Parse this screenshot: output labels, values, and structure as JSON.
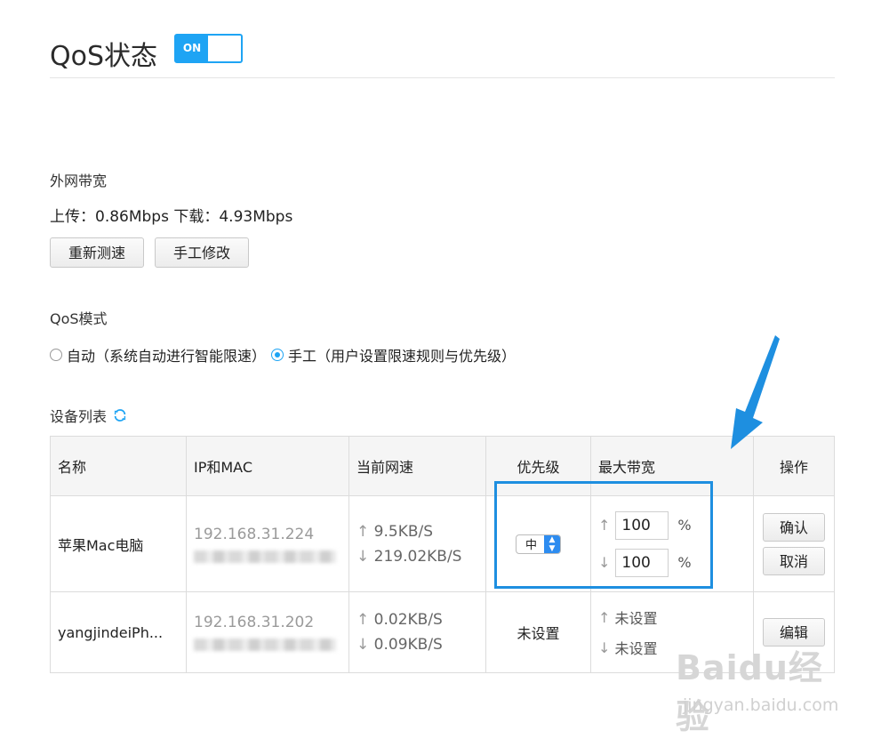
{
  "header": {
    "title": "QoS状态",
    "toggle_label": "ON"
  },
  "wan": {
    "label": "外网带宽",
    "speed_text": "上传：0.86Mbps 下载：4.93Mbps",
    "retest_label": "重新测速",
    "manual_label": "手工修改"
  },
  "mode": {
    "label": "QoS模式",
    "options": [
      {
        "label": "自动（系统自动进行智能限速）",
        "checked": false
      },
      {
        "label": "手工（用户设置限速规则与优先级）",
        "checked": true
      }
    ]
  },
  "devices": {
    "label": "设备列表",
    "columns": [
      "名称",
      "IP和MAC",
      "当前网速",
      "优先级",
      "最大带宽",
      "操作"
    ],
    "rows": [
      {
        "name": "苹果Mac电脑",
        "ip": "192.168.31.224",
        "up_speed": "9.5KB/S",
        "down_speed": "219.02KB/S",
        "priority": "中",
        "max_up": "100",
        "max_down": "100",
        "percent": "%",
        "confirm_label": "确认",
        "cancel_label": "取消"
      },
      {
        "name": "yangjindeiPh...",
        "ip": "192.168.31.202",
        "up_speed": "0.02KB/S",
        "down_speed": "0.09KB/S",
        "priority": "未设置",
        "max_up": "未设置",
        "max_down": "未设置",
        "edit_label": "编辑"
      }
    ]
  },
  "watermark": {
    "logo": "Baidu经验",
    "url": "jingyan.baidu.com"
  },
  "colors": {
    "accent": "#1ea4f4",
    "highlight": "#1e8fe0"
  }
}
